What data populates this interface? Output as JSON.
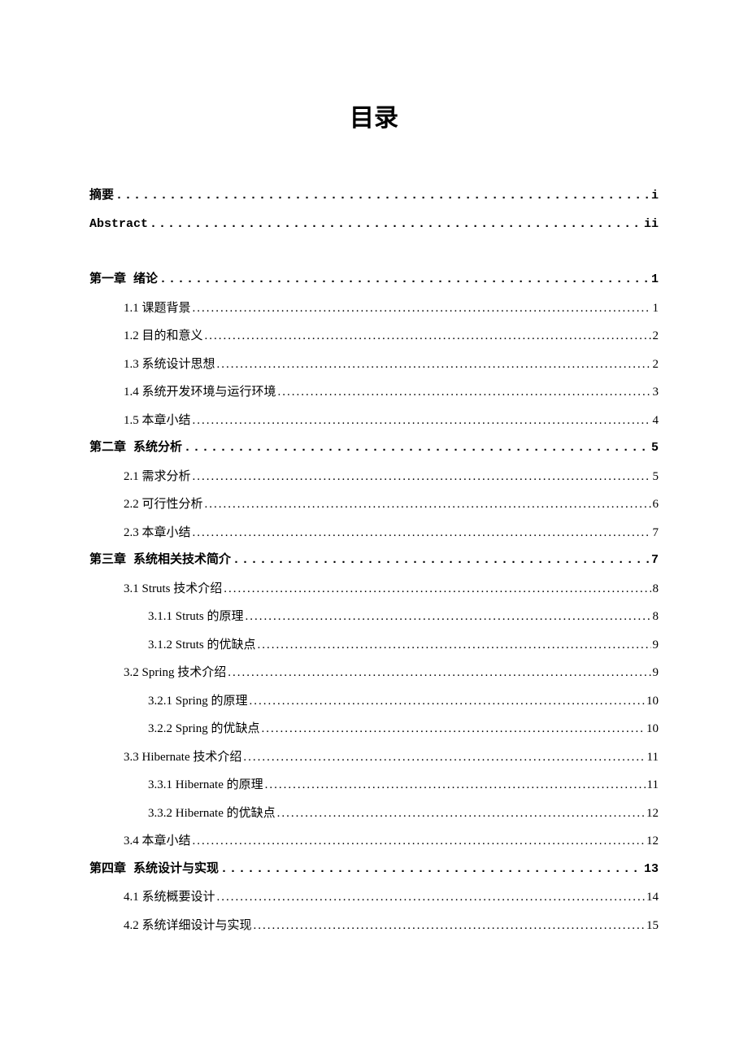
{
  "title": "目录",
  "entries": [
    {
      "level": 0,
      "label": "摘要",
      "page": "i",
      "spacer_after": false
    },
    {
      "level": 0,
      "label": "Abstract",
      "page": "ii",
      "spacer_after": true
    },
    {
      "level": 0,
      "label": "第一章  绪论",
      "page": "1",
      "spacer_after": false
    },
    {
      "level": 1,
      "label": "1.1  课题背景",
      "page": "1",
      "spacer_after": false
    },
    {
      "level": 1,
      "label": "1.2  目的和意义",
      "page": "2",
      "spacer_after": false
    },
    {
      "level": 1,
      "label": "1.3  系统设计思想",
      "page": "2",
      "spacer_after": false
    },
    {
      "level": 1,
      "label": "1.4  系统开发环境与运行环境",
      "page": "3",
      "spacer_after": false
    },
    {
      "level": 1,
      "label": "1.5  本章小结",
      "page": "4",
      "spacer_after": false
    },
    {
      "level": 0,
      "label": "第二章  系统分析",
      "page": "5",
      "spacer_after": false
    },
    {
      "level": 1,
      "label": "2.1  需求分析",
      "page": "5",
      "spacer_after": false
    },
    {
      "level": 1,
      "label": "2.2  可行性分析",
      "page": "6",
      "spacer_after": false
    },
    {
      "level": 1,
      "label": "2.3  本章小结",
      "page": "7",
      "spacer_after": false
    },
    {
      "level": 0,
      "label": "第三章  系统相关技术简介",
      "page": "7",
      "spacer_after": false
    },
    {
      "level": 1,
      "label": "3.1 Struts 技术介绍",
      "page": "8",
      "spacer_after": false
    },
    {
      "level": 2,
      "label": "3.1.1 Struts 的原理",
      "page": "8",
      "spacer_after": false
    },
    {
      "level": 2,
      "label": "3.1.2 Struts 的优缺点",
      "page": "9",
      "spacer_after": false
    },
    {
      "level": 1,
      "label": "3.2 Spring 技术介绍",
      "page": "9",
      "spacer_after": false
    },
    {
      "level": 2,
      "label": "3.2.1 Spring 的原理",
      "page": "10",
      "spacer_after": false
    },
    {
      "level": 2,
      "label": "3.2.2 Spring 的优缺点",
      "page": "10",
      "spacer_after": false
    },
    {
      "level": 1,
      "label": "3.3 Hibernate 技术介绍",
      "page": "11",
      "spacer_after": false
    },
    {
      "level": 2,
      "label": "3.3.1 Hibernate 的原理",
      "page": "11",
      "spacer_after": false
    },
    {
      "level": 2,
      "label": "3.3.2 Hibernate 的优缺点",
      "page": "12",
      "spacer_after": false
    },
    {
      "level": 1,
      "label": "3.4  本章小结",
      "page": "12",
      "spacer_after": false
    },
    {
      "level": 0,
      "label": "第四章  系统设计与实现",
      "page": "13",
      "spacer_after": false
    },
    {
      "level": 1,
      "label": "4.1  系统概要设计",
      "page": "14",
      "spacer_after": false
    },
    {
      "level": 1,
      "label": "4.2  系统详细设计与实现",
      "page": "15",
      "spacer_after": false
    }
  ]
}
